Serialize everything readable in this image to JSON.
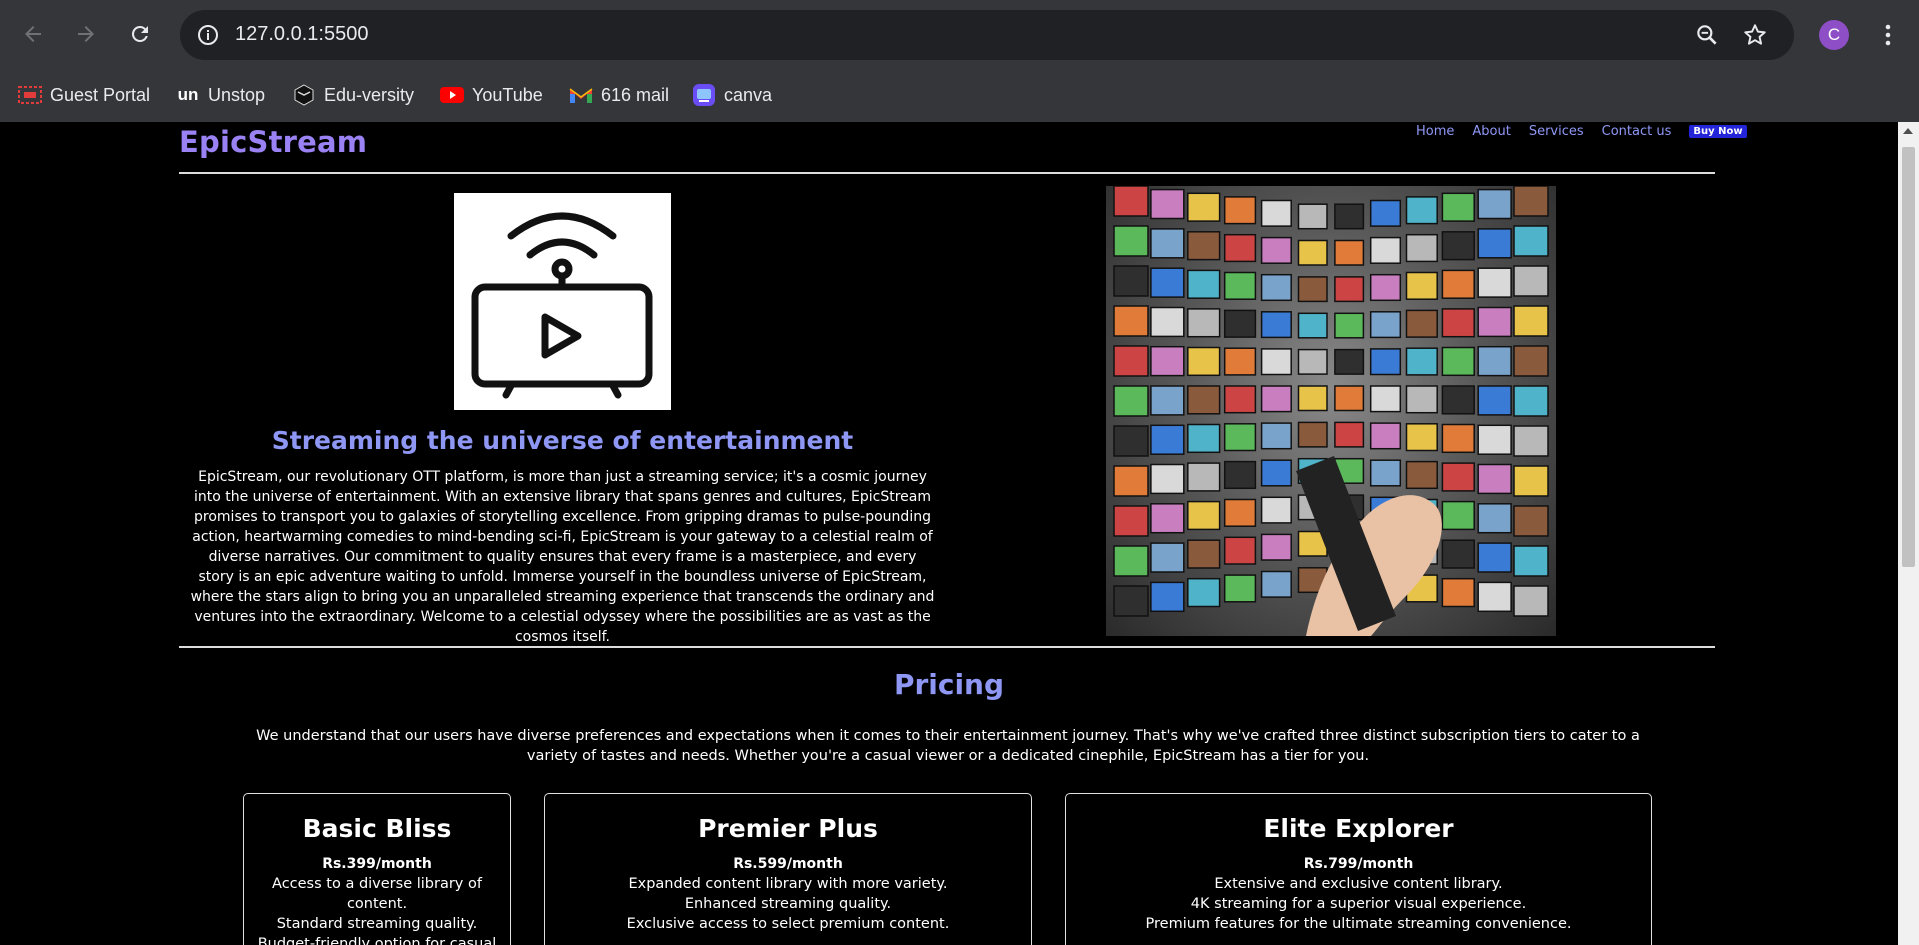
{
  "browser": {
    "url": "127.0.0.1:5500",
    "profile_initial": "C",
    "profile_color": "#8e4ec6",
    "bookmarks": [
      {
        "label": "Guest Portal",
        "icon": "guest-portal-icon"
      },
      {
        "label": "Unstop",
        "icon": "unstop-icon"
      },
      {
        "label": "Edu-versity",
        "icon": "eduversity-icon"
      },
      {
        "label": "YouTube",
        "icon": "youtube-icon"
      },
      {
        "label": "616 mail",
        "icon": "gmail-icon"
      },
      {
        "label": "canva",
        "icon": "canva-icon"
      }
    ]
  },
  "site": {
    "logo": "EpicStream",
    "nav": [
      "Home",
      "About",
      "Services",
      "Contact us"
    ],
    "buy_label": "Buy Now",
    "accent_color": "#8f97f5",
    "logo_color": "#9a82f5",
    "buy_color": "#2424d8"
  },
  "hero": {
    "title": "Streaming the universe of entertainment",
    "text": "EpicStream, our revolutionary OTT platform, is more than just a streaming service; it's a cosmic journey into the universe of entertainment. With an extensive library that spans genres and cultures, EpicStream promises to transport you to galaxies of storytelling excellence. From gripping dramas to pulse-pounding action, heartwarming comedies to mind-bending sci-fi, EpicStream is your gateway to a celestial realm of diverse narratives. Our commitment to quality ensures that every frame is a masterpiece, and every story is an epic adventure waiting to unfold. Immerse yourself in the boundless universe of EpicStream, where the stars align to bring you an unparalleled streaming experience that transcends the ordinary and ventures into the extraordinary. Welcome to a celestial odyssey where the possibilities are as vast as the cosmos itself.",
    "icon": "tv-streaming-icon",
    "image": "tv-wall-remote-image"
  },
  "pricing": {
    "title": "Pricing",
    "intro": "We understand that our users have diverse preferences and expectations when it comes to their entertainment journey. That's why we've crafted three distinct subscription tiers to cater to a variety of tastes and needs. Whether you're a casual viewer or a dedicated cinephile, EpicStream has a tier for you.",
    "plans": [
      {
        "name": "Basic Bliss",
        "price": "Rs.399/month",
        "features": [
          "Access to a diverse library of content.",
          "Standard streaming quality.",
          "Budget-friendly option for casual"
        ]
      },
      {
        "name": "Premier Plus",
        "price": "Rs.599/month",
        "features": [
          "Expanded content library with more variety.",
          "Enhanced streaming quality.",
          "Exclusive access to select premium content."
        ]
      },
      {
        "name": "Elite Explorer",
        "price": "Rs.799/month",
        "features": [
          "Extensive and exclusive content library.",
          "4K streaming for a superior visual experience.",
          "Premium features for the ultimate streaming convenience."
        ]
      }
    ]
  }
}
